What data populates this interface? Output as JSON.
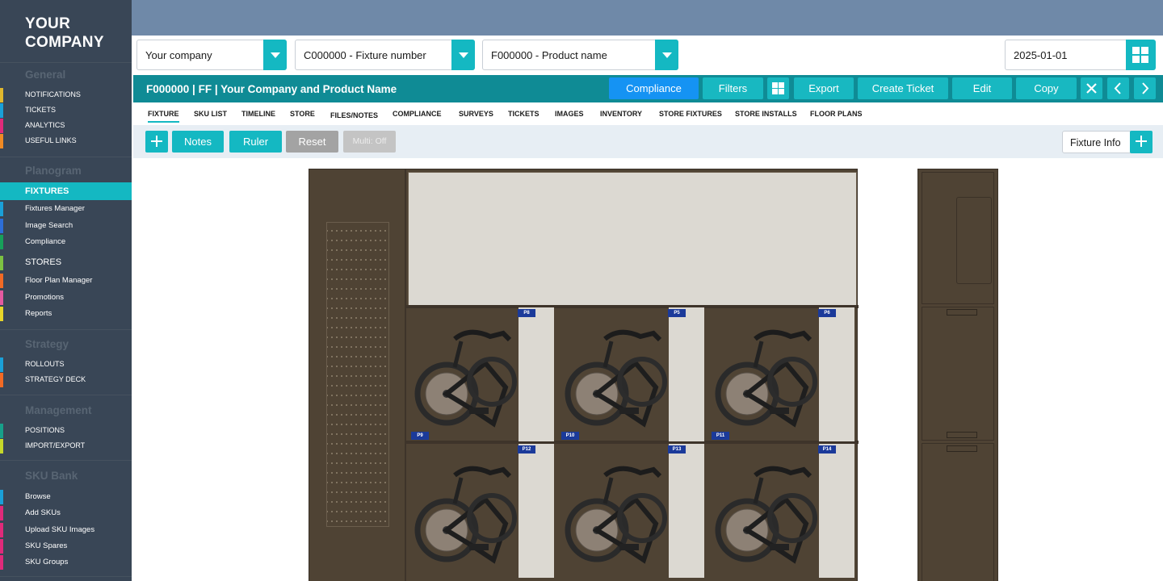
{
  "brand": {
    "logo_line1": "YOUR",
    "logo_line2": "COMPANY"
  },
  "sidebar": {
    "sections": [
      {
        "title": "General",
        "items": [
          "NOTIFICATIONS",
          "TICKETS",
          "ANALYTICS",
          "USEFUL LINKS"
        ]
      },
      {
        "title": "Planogram",
        "items": [
          "FIXTURES",
          "Fixtures Manager",
          "Image Search",
          "Compliance",
          "STORES",
          "Floor Plan Manager",
          "Promotions",
          "Reports"
        ]
      },
      {
        "title": "Strategy",
        "items": [
          "ROLLOUTS",
          "STRATEGY DECK"
        ]
      },
      {
        "title": "Management",
        "items": [
          "POSITIONS",
          "IMPORT/EXPORT"
        ]
      },
      {
        "title": "SKU Bank",
        "items": [
          "Browse",
          "Add SKUs",
          "Upload SKU Images",
          "SKU Spares",
          "SKU Groups"
        ]
      }
    ],
    "active_item": "FIXTURES"
  },
  "filters": {
    "company": "Your company",
    "fixture": "C000000 - Fixture number",
    "product": "F000000 - Product name",
    "date": "2025-01-01"
  },
  "titlebar": {
    "title": "F000000 | FF | Your Company and Product Name",
    "buttons": {
      "compliance": "Compliance",
      "filters": "Filters",
      "export": "Export",
      "create_ticket": "Create Ticket",
      "edit": "Edit",
      "copy": "Copy"
    }
  },
  "tabs": [
    "FIXTURE",
    "SKU LIST",
    "TIMELINE",
    "STORE",
    "FILES/NOTES",
    "COMPLIANCE",
    "SURVEYS",
    "TICKETS",
    "IMAGES",
    "INVENTORY",
    "STORE FIXTURES",
    "STORE INSTALLS",
    "FLOOR PLANS"
  ],
  "active_tab": "FIXTURE",
  "toolbar": {
    "notes": "Notes",
    "ruler": "Ruler",
    "reset": "Reset",
    "multi": "Multi: Off",
    "fixture_info": "Fixture Info"
  },
  "planogram": {
    "bays": [
      {
        "top_tag": "P8",
        "bottom_tag": "P9"
      },
      {
        "top_tag": "P5",
        "bottom_tag": "P10"
      },
      {
        "top_tag": "P6",
        "bottom_tag": "P11"
      },
      {
        "top_tag": "P12",
        "bottom_tag": ""
      },
      {
        "top_tag": "P13",
        "bottom_tag": ""
      },
      {
        "top_tag": "P14",
        "bottom_tag": ""
      }
    ]
  },
  "colors": {
    "sidebar_bg": "#394656",
    "accent": "#14b8c2",
    "titlebar": "#0f8b95",
    "primary_button": "#1593f3",
    "fixture_wood": "#4f4334",
    "tag_blue": "#1b3a9a"
  }
}
